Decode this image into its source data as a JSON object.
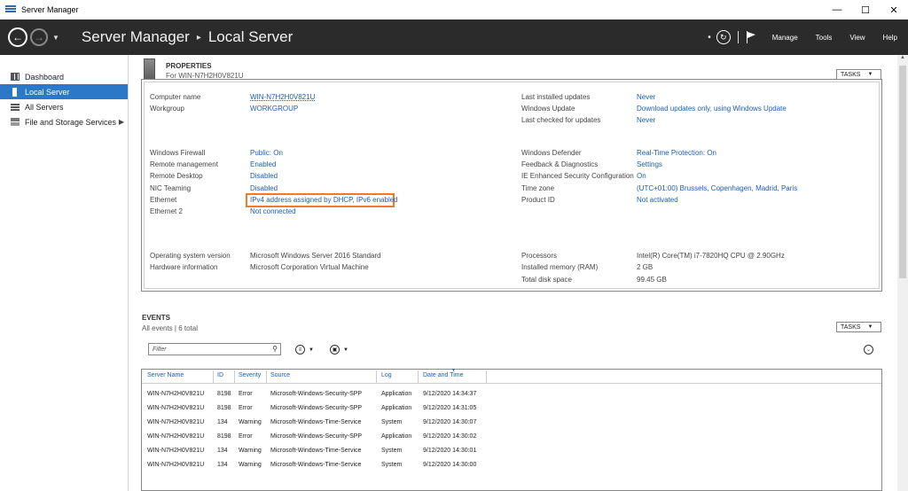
{
  "window": {
    "title": "Server Manager",
    "minimize": "—",
    "maximize": "☐",
    "close": "✕"
  },
  "header": {
    "breadcrumb_root": "Server Manager",
    "breadcrumb_sep": "▸",
    "breadcrumb_current": "Local Server",
    "menus": [
      "Manage",
      "Tools",
      "View",
      "Help"
    ]
  },
  "sidebar": {
    "items": [
      {
        "label": "Dashboard",
        "icon": "dashboard-icon"
      },
      {
        "label": "Local Server",
        "icon": "server-icon",
        "active": true
      },
      {
        "label": "All Servers",
        "icon": "servers-icon"
      },
      {
        "label": "File and Storage Services",
        "icon": "storage-icon",
        "has_children": true
      }
    ]
  },
  "properties": {
    "title": "PROPERTIES",
    "subtitle": "For WIN-N7H2H0V821U",
    "tasks_label": "TASKS",
    "left": [
      {
        "label": "Computer name",
        "value": "WIN-N7H2H0V821U"
      },
      {
        "label": "Workgroup",
        "value": "WORKGROUP"
      },
      {
        "label": "Windows Firewall",
        "value": "Public: On"
      },
      {
        "label": "Remote management",
        "value": "Enabled"
      },
      {
        "label": "Remote Desktop",
        "value": "Disabled"
      },
      {
        "label": "NIC Teaming",
        "value": "Disabled"
      },
      {
        "label": "Ethernet",
        "value": "IPv4 address assigned by DHCP, IPv6 enabled"
      },
      {
        "label": "Ethernet 2",
        "value": "Not connected"
      },
      {
        "label": "Operating system version",
        "value": "Microsoft Windows Server 2016 Standard"
      },
      {
        "label": "Hardware information",
        "value": "Microsoft Corporation Virtual Machine"
      }
    ],
    "right": [
      {
        "label": "Last installed updates",
        "value": "Never"
      },
      {
        "label": "Windows Update",
        "value": "Download updates only, using Windows Update"
      },
      {
        "label": "Last checked for updates",
        "value": "Never"
      },
      {
        "label": "Windows Defender",
        "value": "Real-Time Protection: On"
      },
      {
        "label": "Feedback & Diagnostics",
        "value": "Settings"
      },
      {
        "label": "IE Enhanced Security Configuration",
        "value": "On"
      },
      {
        "label": "Time zone",
        "value": "(UTC+01:00) Brussels, Copenhagen, Madrid, Paris"
      },
      {
        "label": "Product ID",
        "value": "Not activated"
      },
      {
        "label": "Processors",
        "value": "Intel(R) Core(TM) i7-7820HQ CPU @ 2.90GHz"
      },
      {
        "label": "Installed memory (RAM)",
        "value": "2 GB"
      },
      {
        "label": "Total disk space",
        "value": "99.45 GB"
      }
    ]
  },
  "events": {
    "title": "EVENTS",
    "subtitle": "All events | 6 total",
    "tasks_label": "TASKS",
    "filter_placeholder": "Filter",
    "columns": [
      "Server Name",
      "ID",
      "Severity",
      "Source",
      "Log",
      "Date and Time"
    ],
    "rows": [
      [
        "WIN-N7H2H0V821U",
        "8198",
        "Error",
        "Microsoft-Windows-Security-SPP",
        "Application",
        "9/12/2020 14:34:37"
      ],
      [
        "WIN-N7H2H0V821U",
        "8198",
        "Error",
        "Microsoft-Windows-Security-SPP",
        "Application",
        "9/12/2020 14:31:05"
      ],
      [
        "WIN-N7H2H0V821U",
        "134",
        "Warning",
        "Microsoft-Windows-Time-Service",
        "System",
        "9/12/2020 14:30:07"
      ],
      [
        "WIN-N7H2H0V821U",
        "8198",
        "Error",
        "Microsoft-Windows-Security-SPP",
        "Application",
        "9/12/2020 14:30:02"
      ],
      [
        "WIN-N7H2H0V821U",
        "134",
        "Warning",
        "Microsoft-Windows-Time-Service",
        "System",
        "9/12/2020 14:30:01"
      ],
      [
        "WIN-N7H2H0V821U",
        "134",
        "Warning",
        "Microsoft-Windows-Time-Service",
        "System",
        "9/12/2020 14:30:00"
      ]
    ]
  },
  "colors": {
    "accent": "#2b78c8",
    "header_bg": "#2b2b2b",
    "link": "#1a5fb4",
    "highlight": "#f07a2a"
  }
}
